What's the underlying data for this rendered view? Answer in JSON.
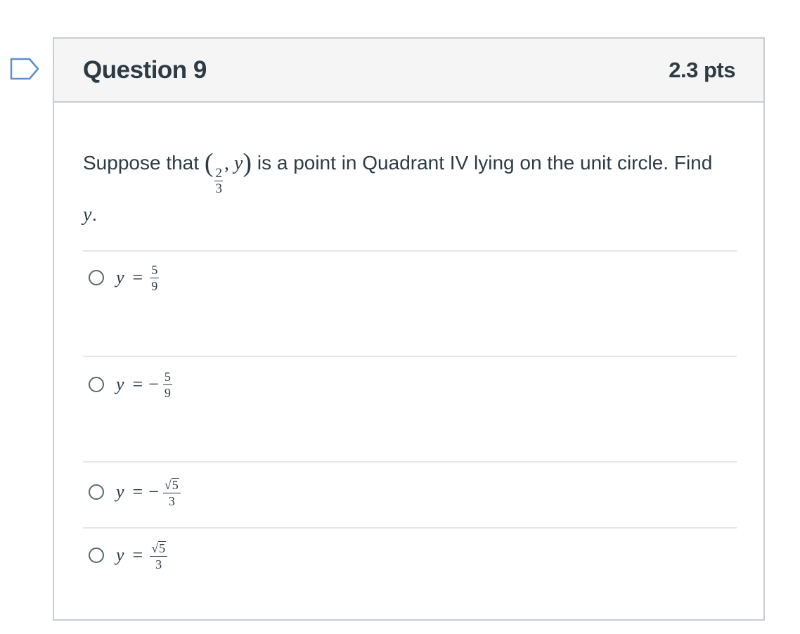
{
  "question": {
    "title": "Question 9",
    "points": "2.3 pts",
    "text_before": "Suppose that",
    "point_numerator": "2",
    "point_denominator": "3",
    "point_var": "y",
    "text_after": "is a point in Quadrant IV lying on the unit circle. Find",
    "find_var": "y",
    "text_end": "."
  },
  "answers": [
    {
      "var": "y",
      "op": "=",
      "sign": "",
      "numerator": "5",
      "radical": false,
      "denominator": "9"
    },
    {
      "var": "y",
      "op": "=",
      "sign": "−",
      "numerator": "5",
      "radical": false,
      "denominator": "9"
    },
    {
      "var": "y",
      "op": "=",
      "sign": "−",
      "numerator": "5",
      "radical": true,
      "denominator": "3"
    },
    {
      "var": "y",
      "op": "=",
      "sign": "",
      "numerator": "5",
      "radical": true,
      "denominator": "3"
    }
  ],
  "colors": {
    "flag_border": "#5b8fc7",
    "card_border": "#c7cdd1",
    "header_bg": "#f5f5f5",
    "text": "#2d3b45"
  },
  "icons": {
    "flag": "flag-question-icon",
    "radio": "radio-unchecked-icon"
  }
}
